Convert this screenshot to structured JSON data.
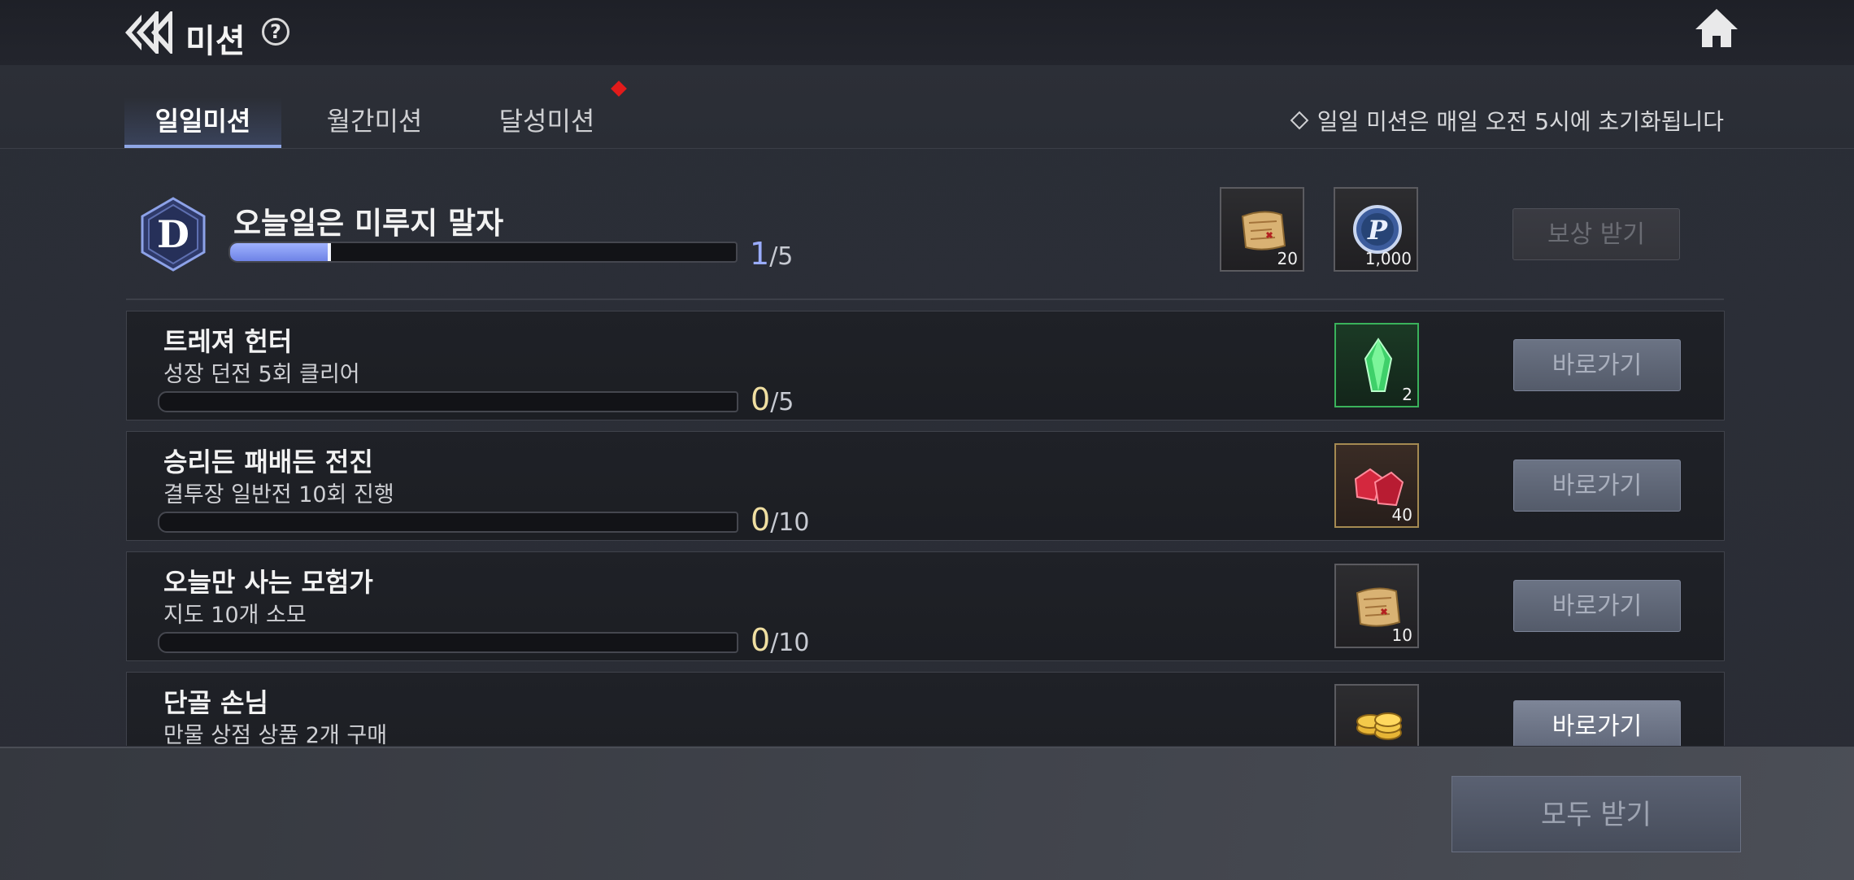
{
  "header": {
    "title": "미션",
    "help_glyph": "?"
  },
  "tabs": [
    {
      "label": "일일미션",
      "active": true
    },
    {
      "label": "월간미션",
      "active": false
    },
    {
      "label": "달성미션",
      "active": false,
      "badge": true
    }
  ],
  "notice": "일일 미션은 매일 오전 5시에 초기화됩니다",
  "daily": {
    "grade": "D",
    "title": "오늘일은 미루지 말자",
    "progress_current": "1",
    "progress_total": "/5",
    "progress_fraction": 0.2,
    "rewards": [
      {
        "icon": "map-scroll-icon",
        "qty": "20"
      },
      {
        "icon": "p-coin-icon",
        "qty": "1,000"
      }
    ],
    "claim_label": "보상 받기"
  },
  "missions": [
    {
      "title": "트레져 헌터",
      "desc": "성장 던전 5회 클리어",
      "current": "0",
      "total": "/5",
      "reward_icon": "green-gem-icon",
      "reward_qty": "2",
      "button": "바로가기"
    },
    {
      "title": "승리든 패배든 전진",
      "desc": "결투장 일반전 10회 진행",
      "current": "0",
      "total": "/10",
      "reward_icon": "red-crystal-icon",
      "reward_qty": "40",
      "button": "바로가기"
    },
    {
      "title": "오늘만 사는 모험가",
      "desc": "지도 10개 소모",
      "current": "0",
      "total": "/10",
      "reward_icon": "map-scroll-icon",
      "reward_qty": "10",
      "button": "바로가기"
    },
    {
      "title": "단골 손님",
      "desc": "만물 상점 상품 2개 구매",
      "current": "",
      "total": "",
      "reward_icon": "gold-coins-icon",
      "reward_qty": "",
      "button": "바로가기"
    }
  ],
  "footer": {
    "claim_all_label": "모두 받기"
  },
  "colors": {
    "accent_blue": "#9aacff",
    "badge_red": "#e21b1b",
    "count_gold": "#f0dfa2"
  }
}
